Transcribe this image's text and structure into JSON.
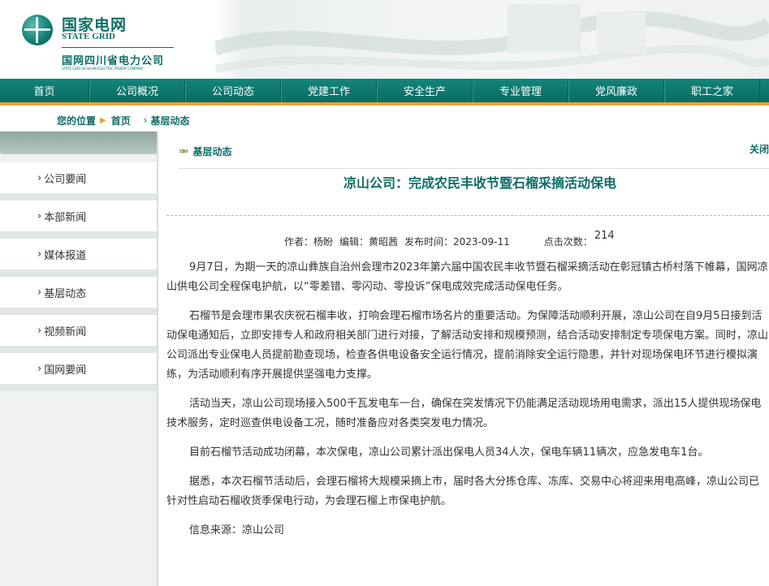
{
  "header": {
    "logo_cn": "国家电网",
    "logo_en": "STATE GRID",
    "company_name": "国网四川省电力公司",
    "company_name_en": "STATE GRID SICHUAN ELECTRIC POWER COMPANY"
  },
  "nav": {
    "items": [
      {
        "label": "首页"
      },
      {
        "label": "公司概况"
      },
      {
        "label": "公司动态"
      },
      {
        "label": "党建工作"
      },
      {
        "label": "安全生产"
      },
      {
        "label": "专业管理"
      },
      {
        "label": "党风廉政"
      },
      {
        "label": "职工之家"
      }
    ]
  },
  "breadcrumb": {
    "prefix": "您的位置",
    "home": "首页",
    "current": "基层动态"
  },
  "sidebar": {
    "items": [
      {
        "label": "公司要闻"
      },
      {
        "label": "本部新闻"
      },
      {
        "label": "媒体报道"
      },
      {
        "label": "基层动态"
      },
      {
        "label": "视频新闻"
      },
      {
        "label": "国网要闻"
      }
    ]
  },
  "main": {
    "section_title": "基层动态",
    "close_label": "关闭",
    "title": "凉山公司：完成农民丰收节暨石榴采摘活动保电",
    "meta": {
      "author": "作者：杨盼",
      "editor": "编辑：黄昭茜",
      "publish_time": "发布时间：2023-09-11",
      "hits_label": "点击次数：",
      "hits_value": "214"
    },
    "paragraphs": [
      "9月7日，为期一天的凉山彝族自治州会理市2023年第六届中国农民丰收节暨石榴采摘活动在彰冠镇古桥村落下帷幕，国网凉山供电公司全程保电护航，以“零差错、零闪动、零投诉”保电成效完成活动保电任务。",
      "石榴节是会理市果农庆祝石榴丰收，打响会理石榴市场名片的重要活动。为保障活动顺利开展，凉山公司在自9月5日接到活动保电通知后，立即安排专人和政府相关部门进行对接，了解活动安排和规模预测，结合活动安排制定专项保电方案。同时，凉山公司派出专业保电人员提前勘查现场，检查各供电设备安全运行情况，提前消除安全运行隐患，并针对现场保电环节进行模拟演练，为活动顺利有序开展提供坚强电力支撑。",
      "活动当天，凉山公司现场接入500千瓦发电车一台，确保在突发情况下仍能满足活动现场用电需求，派出15人提供现场保电技术服务，定时巡查供电设备工况，随时准备应对各类突发电力情况。",
      "目前石榴节活动成功闭幕，本次保电，凉山公司累计派出保电人员34人次，保电车辆11辆次，应急发电车1台。",
      "据悉，本次石榴节活动后，会理石榴将大规模采摘上市，届时各大分拣仓库、冻库、交易中心将迎来用电高峰，凉山公司已针对性启动石榴收货季保电行动，为会理石榴上市保电护航。",
      "信息来源：凉山公司"
    ]
  },
  "colors": {
    "brand": "#0d6e66",
    "nav_bg": "#0b6b62",
    "accent": "#e7a23b"
  }
}
